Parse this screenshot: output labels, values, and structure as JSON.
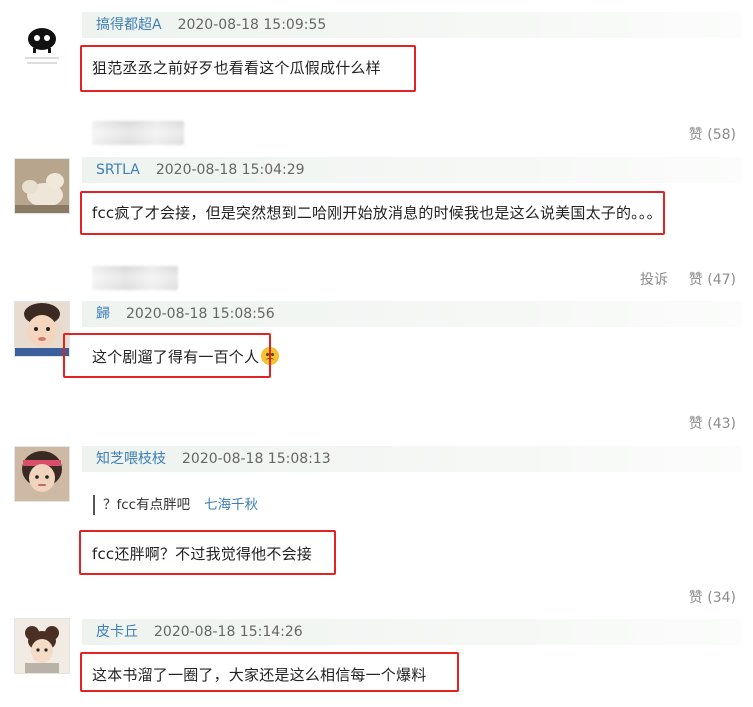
{
  "comments": [
    {
      "username": "搞得都超A",
      "time": "2020-08-18 15:09:55",
      "avatar_desc": "猪猪存讲我很容易生气",
      "text": "狙范丞丞之前好歹也看看这个瓜假成什么样"
    },
    {
      "username": "SRTLA",
      "time": "2020-08-18 15:04:29",
      "avatar_desc": "dogs",
      "text": "fcc疯了才会接，但是突然想到二哈刚开始放消息的时候我也是这么说美国太子的。。。"
    },
    {
      "username": "歸",
      "time": "2020-08-18 15:08:56",
      "avatar_desc": "baby",
      "text": "这个剧遛了得有一百个人",
      "emoji": "emoji-sweat-icon"
    },
    {
      "username": "知芝喂枝枝",
      "time": "2020-08-18 15:08:13",
      "avatar_desc": "girl",
      "quote_text": "？fcc有点胖吧",
      "quote_author": "七海千秋",
      "text": "fcc还胖啊？不过我觉得他不会接"
    },
    {
      "username": "皮卡丘",
      "time": "2020-08-18 15:14:26",
      "avatar_desc": "girl-2",
      "text": "这本书溜了一圈了，大家还是这么相信每一个爆料"
    }
  ],
  "footers": [
    {
      "like_label": "赞 (58)",
      "report_label": ""
    },
    {
      "like_label": "赞 (47)",
      "report_label": "投诉"
    },
    {
      "like_label": "赞 (43)",
      "report_label": ""
    },
    {
      "like_label": "赞 (34)",
      "report_label": ""
    }
  ],
  "colors": {
    "username": "#3e7fb6",
    "highlight_box": "#e32222",
    "meta_bg": "#eef3ef",
    "action_text": "#8c8c8c"
  }
}
